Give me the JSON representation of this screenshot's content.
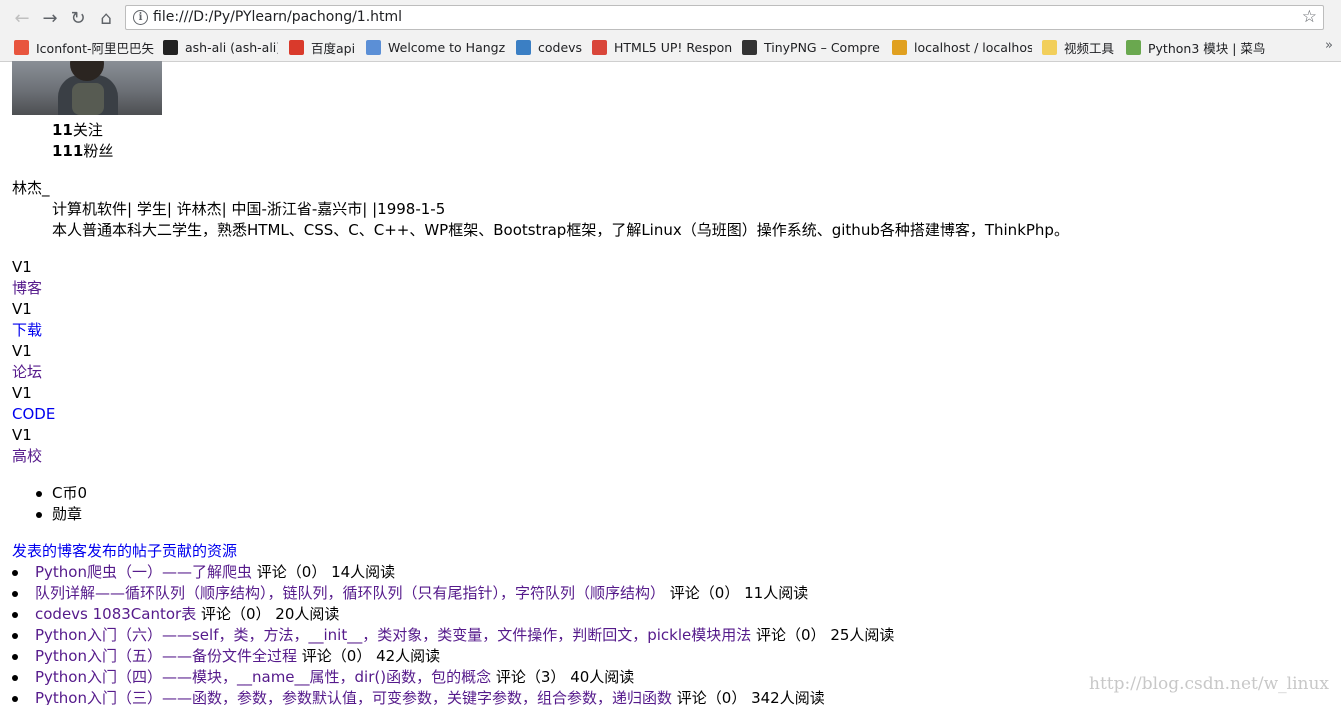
{
  "browser": {
    "url": "file:///D:/Py/PYlearn/pachong/1.html",
    "bookmarks": [
      {
        "label": "Iconfont-阿里巴巴矢",
        "icon": "iconfont-icon",
        "color": "#e8553e"
      },
      {
        "label": "ash-ali (ash-ali)",
        "icon": "github-icon",
        "color": "#222222"
      },
      {
        "label": "百度api",
        "icon": "map-pin-icon",
        "color": "#d93a2b"
      },
      {
        "label": "Welcome to Hangzl",
        "icon": "globe-icon",
        "color": "#5b8fd6"
      },
      {
        "label": "codevs",
        "icon": "codevs-icon",
        "color": "#3b7fc4"
      },
      {
        "label": "HTML5 UP! Respon",
        "icon": "html5up-icon",
        "color": "#d9463a"
      },
      {
        "label": "TinyPNG – Compre",
        "icon": "panda-icon",
        "color": "#333333"
      },
      {
        "label": "localhost / localhos",
        "icon": "phpmyadmin-icon",
        "color": "#e0a020"
      },
      {
        "label": "视频工具",
        "icon": "folder-icon",
        "color": "#f2cf5b"
      },
      {
        "label": "Python3 模块 | 菜鸟",
        "icon": "runoob-icon",
        "color": "#6aa84f"
      }
    ]
  },
  "profile": {
    "follow_count": "11",
    "follow_label": "关注",
    "fans_count": "111",
    "fans_label": "粉丝",
    "username": "林杰_",
    "info_line": "计算机软件| 学生| 许林杰| 中国-浙江省-嘉兴市| |1998-1-5",
    "bio": "本人普通本科大二学生，熟悉HTML、CSS、C、C++、WP框架、Bootstrap框架，了解Linux（乌班图）操作系统、github各种搭建博客，ThinkPhp。"
  },
  "levels": [
    {
      "level": "V1",
      "label": "博客"
    },
    {
      "level": "V1",
      "label": "下载"
    },
    {
      "level": "V1",
      "label": "论坛"
    },
    {
      "level": "V1",
      "label": "CODE"
    },
    {
      "level": "V1",
      "label": "高校"
    }
  ],
  "stats": [
    "C币0",
    "勋章"
  ],
  "tabs_line": "发表的博客发布的帖子贡献的资源",
  "articles": [
    {
      "title": "Python爬虫（一）——了解爬虫",
      "meta": "评论（0） 14人阅读"
    },
    {
      "title": "队列详解——循环队列（顺序结构），链队列，循环队列（只有尾指针），字符队列（顺序结构）",
      "meta": "评论（0） 11人阅读"
    },
    {
      "title": "codevs 1083Cantor表",
      "meta": "评论（0） 20人阅读"
    },
    {
      "title": "Python入门（六）——self，类，方法，__init__，类对象，类变量，文件操作，判断回文，pickle模块用法",
      "meta": "评论（0） 25人阅读"
    },
    {
      "title": "Python入门（五）——备份文件全过程",
      "meta": "评论（0） 42人阅读"
    },
    {
      "title": "Python入门（四）——模块，__name__属性，dir()函数，包的概念",
      "meta": "评论（3） 40人阅读"
    },
    {
      "title": "Python入门（三）——函数，参数，参数默认值，可变参数，关键字参数，组合参数，递归函数",
      "meta": "评论（0） 342人阅读"
    }
  ],
  "watermark": "http://blog.csdn.net/w_linux"
}
